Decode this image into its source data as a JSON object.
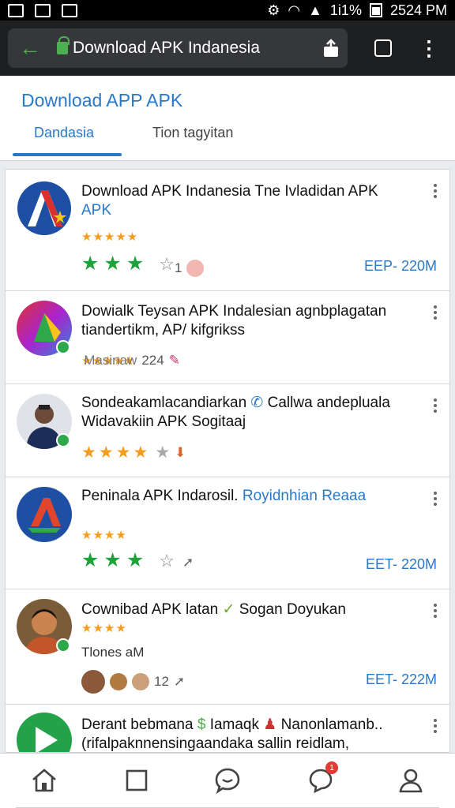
{
  "status_bar": {
    "signal_text": "1i1%",
    "time": "2524 PM"
  },
  "browser": {
    "url_title": "Download APK Indanesia",
    "icons": [
      "back-arrow-icon",
      "lock-icon",
      "share-icon",
      "tabs-icon",
      "more-vert-icon"
    ]
  },
  "site": {
    "title": "Download APP APK",
    "tabs": [
      {
        "label": "Dandasia",
        "active": true
      },
      {
        "label": "Tion tagyitan",
        "active": false
      }
    ]
  },
  "apps": [
    {
      "title": "Download APK Indanesia Tne Ivladidan APK",
      "title_blue": "APK",
      "stars_small": "★★★★★",
      "green_stars": "★★★",
      "empty_star": "☆",
      "count": "1",
      "size": "EEP- 220M"
    },
    {
      "title": "Dowialk Teysan APK Indalesian agnbplagatan tiandertikm, AP/ kifgrikss",
      "rating_label": "Masinaw",
      "count": "224"
    },
    {
      "title": "Sondeakamlacandiarkan",
      "title_extra": "Callwa andepluala",
      "title_line2": "Widavakiin APK Sogitaaj",
      "stars": "★★★★",
      "empty_star": "★"
    },
    {
      "title": "Peninala APK Indarosil.",
      "title_blue": "Royidnhian Reaaa",
      "stars_small": "★★★★",
      "green_stars": "★★★",
      "empty_star": "☆",
      "size": "EET- 220M"
    },
    {
      "title": "Cownibad APK latan",
      "title_extra": "Sogan Doyukan",
      "stars_small": "★★★★",
      "subtitle": "Tlones aM",
      "count": "12",
      "size": "EET- 222M"
    },
    {
      "title": "Derant bebmana",
      "title_extra": "Iamaqk",
      "title_extra2": "Nanonlamanb..",
      "title_line2": "(rifalpaknnensingaandaka sallin reidlam,"
    }
  ],
  "bottom_nav": {
    "notif_badge": "1",
    "items": [
      "home-icon",
      "square-icon",
      "chat-icon",
      "notifications-icon",
      "profile-icon"
    ]
  },
  "colors": {
    "accent": "#2a78c8",
    "green_star": "#1ea23a",
    "orange_star": "#f39c1e",
    "browser_bar": "#1e1f21"
  }
}
